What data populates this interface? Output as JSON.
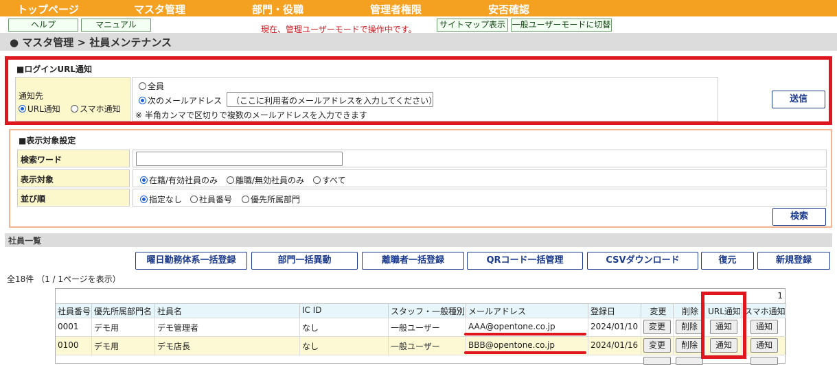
{
  "nav": {
    "items": [
      "トップページ",
      "マスタ管理",
      "部門・役職",
      "管理者権限",
      "安否確認"
    ]
  },
  "subnav": {
    "help": "ヘルプ",
    "manual": "マニュアル",
    "mode_message": "現在、管理ユーザーモードで操作中です。",
    "sitemap": "サイトマップ表示",
    "switch_mode": "一般ユーザーモードに切替"
  },
  "breadcrumb": "● マスタ管理 > 社員メンテナンス",
  "login_url": {
    "title": "■ログインURL通知",
    "notify_to": "通知先",
    "url_notify": "URL通知",
    "smartphone_notify": "スマホ通知",
    "all": "全員",
    "email_option": "次のメールアドレス",
    "email_placeholder": "（ここに利用者のメールアドレスを入力してください）",
    "note": "※ 半角カンマで区切りで複数のメールアドレスを入力できます",
    "send": "送信"
  },
  "display": {
    "title": "■表示対象設定",
    "keyword_label": "検索ワード",
    "keyword_value": "",
    "target_label": "表示対象",
    "target_options": [
      "在籍/有効社員のみ",
      "離職/無効社員のみ",
      "すべて"
    ],
    "order_label": "並び順",
    "order_options": [
      "指定なし",
      "社員番号",
      "優先所属部門"
    ],
    "search": "検索"
  },
  "list": {
    "title": "社員一覧",
    "actions": [
      "曜日勤務体系一括登録",
      "部門一括異動",
      "離職者一括登録",
      "QRコード一括管理",
      "CSVダウンロード",
      "復元",
      "新規登録"
    ],
    "count_text": "全18件 （1 / 1ページを表示）",
    "page": "1",
    "headers": [
      "社員番号",
      "優先所属部門名",
      "社員名",
      "IC ID",
      "スタッフ・一般種別",
      "メールアドレス",
      "登録日",
      "変更",
      "削除",
      "URL通知",
      "スマホ通知"
    ],
    "rows": [
      {
        "id": "0001",
        "dept": "デモ用",
        "name": "デモ管理者",
        "ic": "なし",
        "type": "一般ユーザー",
        "email": "AAA@opentone.co.jp",
        "date": "2024/01/10",
        "edit": "変更",
        "delete": "削除",
        "url": "通知",
        "sp": "通知"
      },
      {
        "id": "0100",
        "dept": "デモ用",
        "name": "デモ店長",
        "ic": "なし",
        "type": "一般ユーザー",
        "email": "BBB@opentone.co.jp",
        "date": "2024/01/16",
        "edit": "変更",
        "delete": "削除",
        "url": "通知",
        "sp": "通知"
      }
    ]
  },
  "colors": {
    "nav": "#f4a021",
    "highlight": "#e0161e",
    "accent": "#1b3a8c",
    "label_bg": "#fdf7cc"
  }
}
